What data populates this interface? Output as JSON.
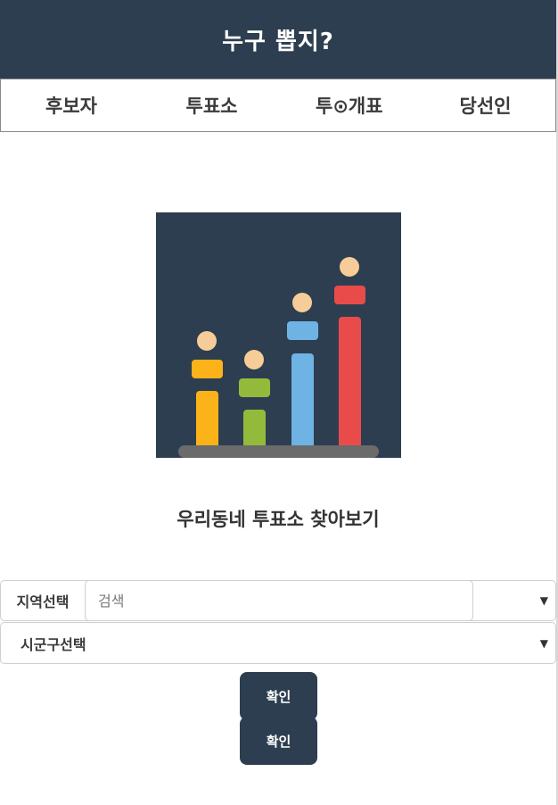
{
  "header": {
    "title": "누구 뽑지?"
  },
  "nav": {
    "items": [
      {
        "label": "후보자"
      },
      {
        "label": "투표소"
      },
      {
        "label": "투⊙개표"
      },
      {
        "label": "당선인"
      }
    ]
  },
  "hero": {
    "icon": "election-bar-chart-illustration",
    "background": "#2d3e50",
    "figure_colors": [
      "#fbb319",
      "#94ba3c",
      "#6eb3e4",
      "#e94b4b"
    ]
  },
  "main": {
    "subtitle": "우리동네 투표소 찾아보기"
  },
  "form": {
    "region_label": "지역선택",
    "search_placeholder": "검색",
    "district_label": "시군구선택",
    "confirm_label_1": "확인",
    "confirm_label_2": "확인"
  },
  "colors": {
    "primary": "#2d3e50",
    "text": "#333333"
  }
}
